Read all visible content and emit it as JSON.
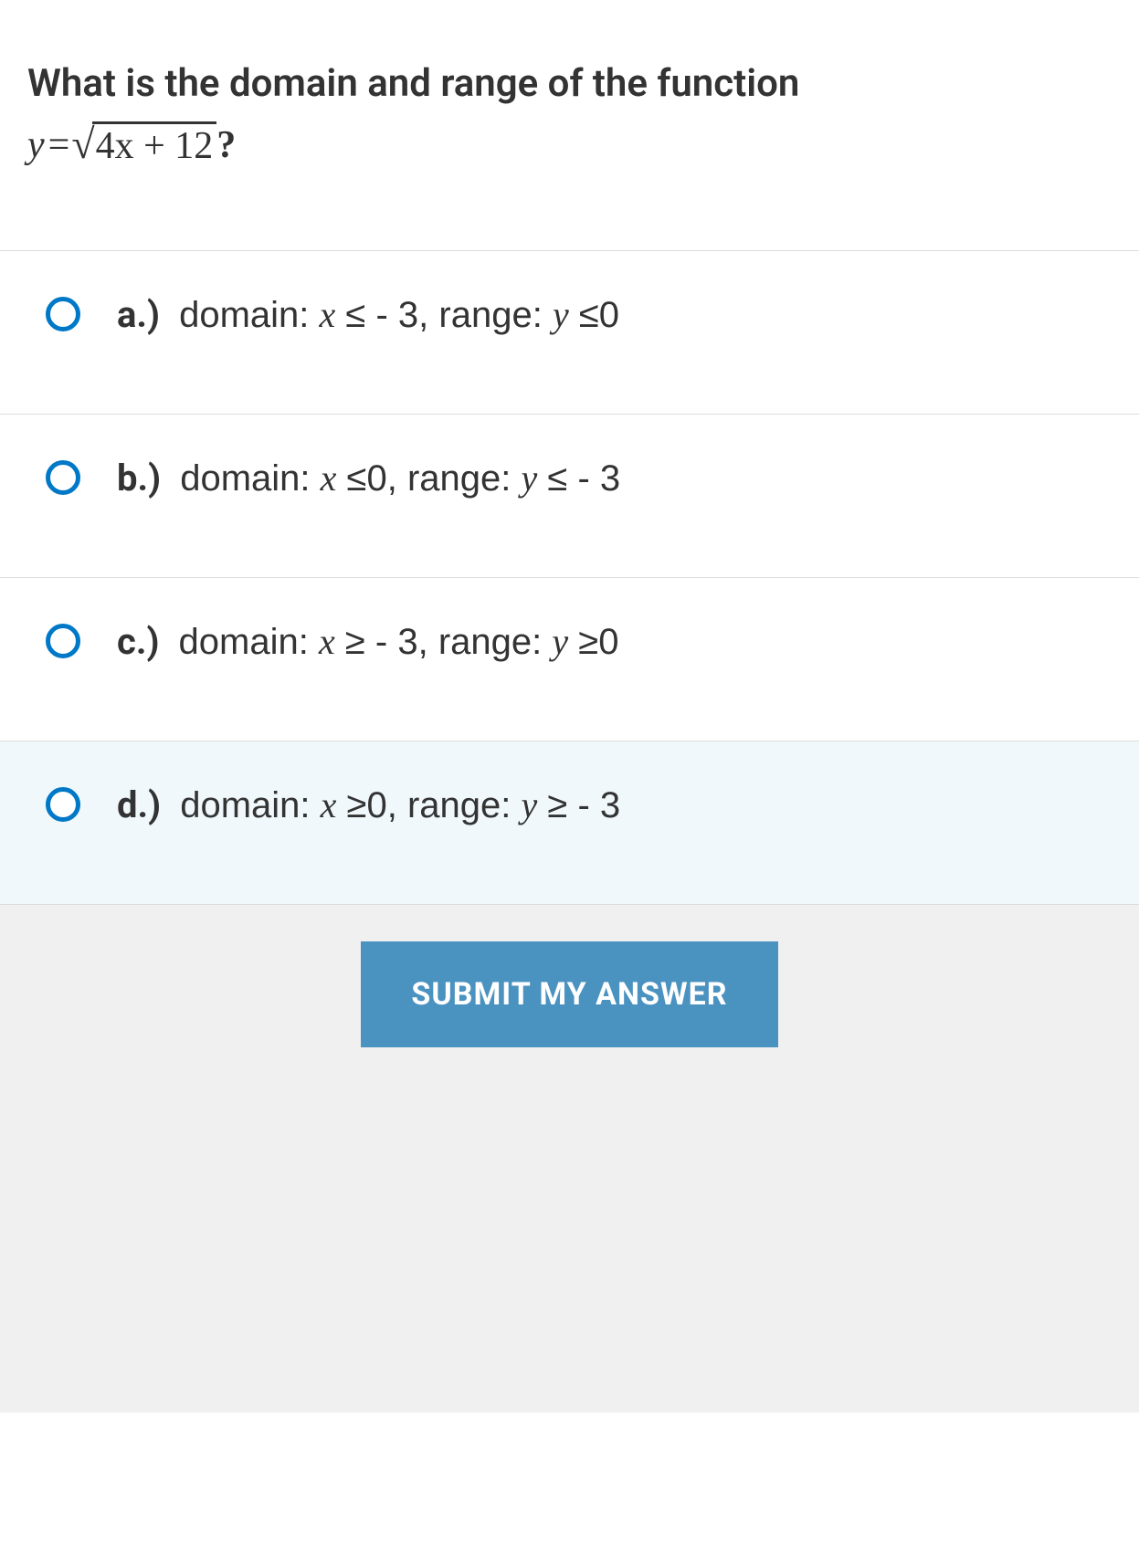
{
  "question": {
    "prompt": "What is the domain and range of the function",
    "equation_y": "y",
    "equation_eq": "=",
    "equation_radicand": "4x + 12",
    "equation_q": "?"
  },
  "answers": [
    {
      "label": "a.)",
      "text_prefix": "domain: ",
      "var1": "x",
      "rel1": "≤",
      "val1": " - 3",
      "mid": ", range: ",
      "var2": "y",
      "rel2": "≤",
      "val2": "0",
      "highlighted": false
    },
    {
      "label": "b.)",
      "text_prefix": "domain: ",
      "var1": "x",
      "rel1": "≤",
      "val1": "0",
      "mid": ", range: ",
      "var2": "y",
      "rel2": "≤",
      "val2": " - 3",
      "highlighted": false
    },
    {
      "label": "c.)",
      "text_prefix": "domain: ",
      "var1": "x",
      "rel1": "≥",
      "val1": " - 3",
      "mid": ", range: ",
      "var2": "y",
      "rel2": "≥",
      "val2": "0",
      "highlighted": false
    },
    {
      "label": "d.)",
      "text_prefix": "domain: ",
      "var1": "x",
      "rel1": "≥",
      "val1": "0",
      "mid": ", range: ",
      "var2": "y",
      "rel2": "≥",
      "val2": " - 3",
      "highlighted": true
    }
  ],
  "submit": {
    "label": "SUBMIT MY ANSWER"
  }
}
